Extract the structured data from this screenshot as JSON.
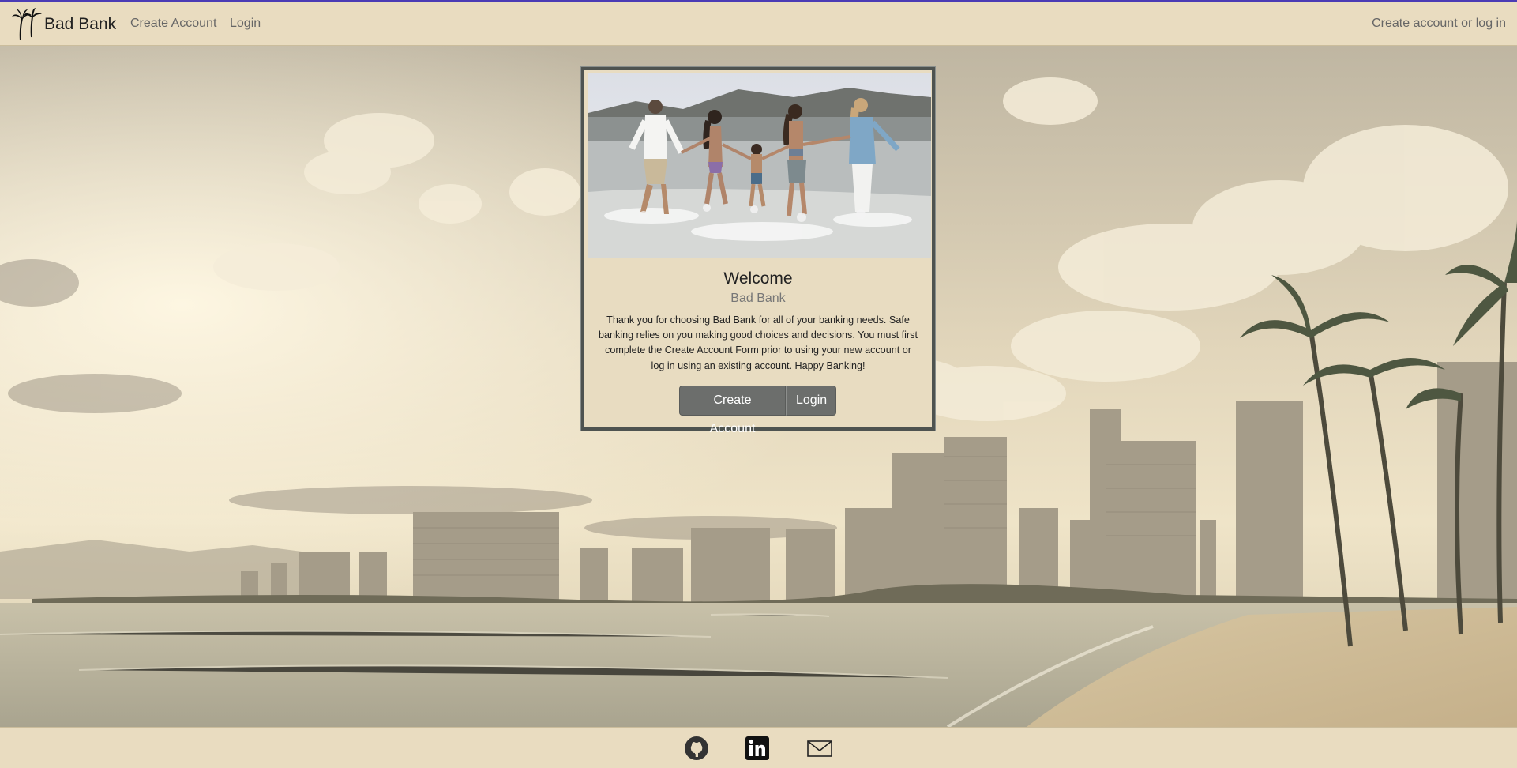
{
  "navbar": {
    "brand": "Bad Bank",
    "links": [
      {
        "label": "Create Account"
      },
      {
        "label": "Login"
      }
    ],
    "status": "Create account or log in"
  },
  "card": {
    "image_alt": "family-running-on-beach",
    "title": "Welcome",
    "subtitle": "Bad Bank",
    "text": "Thank you for choosing Bad Bank for all of your banking needs. Safe banking relies on you making good choices and decisions. You must first complete the Create Account Form prior to using your new account or log in using an existing account. Happy Banking!",
    "buttons": {
      "create_label": "Create Account",
      "login_label": "Login"
    }
  },
  "footer": {
    "icons": [
      "github-icon",
      "linkedin-icon",
      "email-icon"
    ]
  },
  "colors": {
    "nav_bg": "#e9dcc0",
    "card_border": "#4e5350",
    "button_bg": "#6c6e6c",
    "top_accent": "#4a3bb5"
  }
}
